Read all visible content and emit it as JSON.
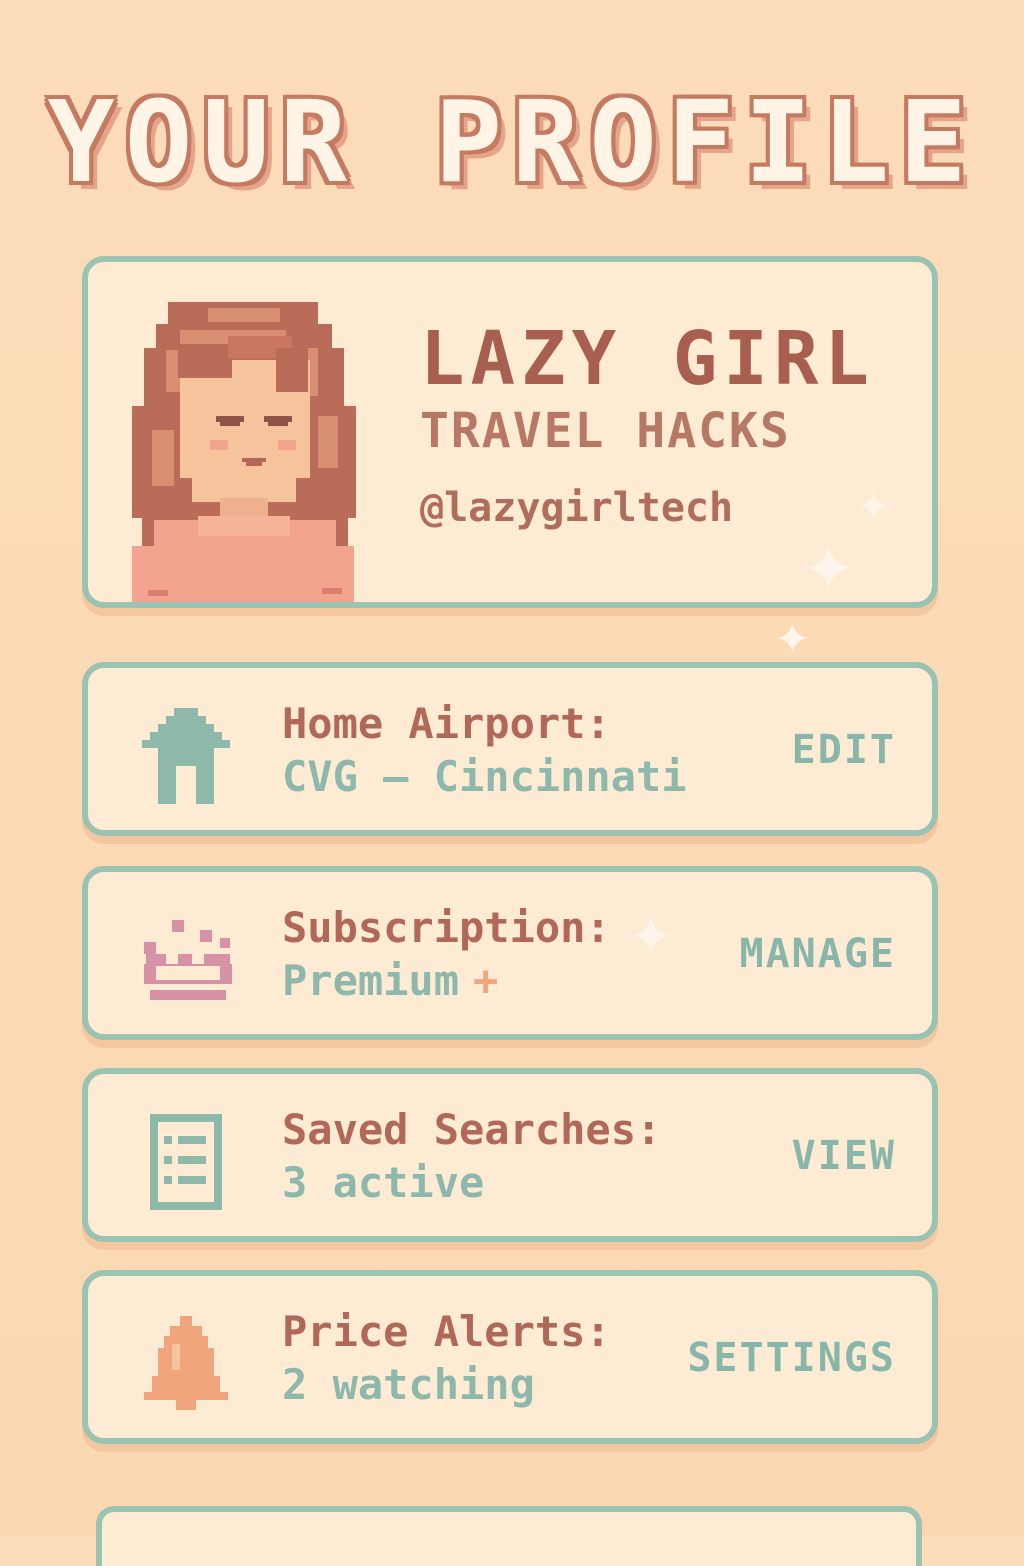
{
  "page": {
    "title": "YOUR PROFILE"
  },
  "profile": {
    "name": "LAZY GIRL",
    "subtitle": "TRAVEL HACKS",
    "handle": "@lazygirltech"
  },
  "cards": {
    "home": {
      "label": "Home Airport:",
      "value": "CVG – Cincinnati",
      "action": "EDIT",
      "icon": "house-icon"
    },
    "subscription": {
      "label": "Subscription:",
      "value": "Premium",
      "accent": "+",
      "action": "MANAGE",
      "icon": "crown-icon"
    },
    "saved": {
      "label": "Saved Searches:",
      "value": "3 active",
      "action": "VIEW",
      "icon": "list-icon"
    },
    "alerts": {
      "label": "Price Alerts:",
      "value": "2 watching",
      "action": "SETTINGS",
      "icon": "bell-icon"
    }
  },
  "colors": {
    "background": "#fbdcb8",
    "card_bg": "#fdebd3",
    "card_border": "#9bc3b2",
    "title_fill": "#fff4e6",
    "title_outline": "#c57a62",
    "primary_text": "#a85f4f",
    "secondary_text": "#8db8ab",
    "accent": "#f0a77f"
  }
}
